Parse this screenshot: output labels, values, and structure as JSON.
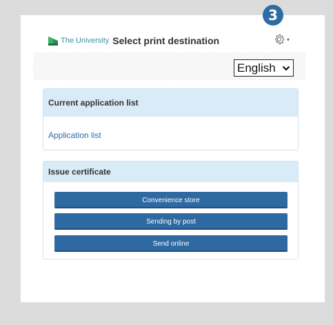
{
  "step": {
    "number": "3"
  },
  "header": {
    "logo_text": "The University",
    "title": "Select print destination",
    "settings_icon": "gear-icon"
  },
  "language": {
    "selected": "English"
  },
  "current_list": {
    "heading": "Current application list",
    "link_label": "Application list"
  },
  "issue": {
    "heading": "Issue certificate",
    "buttons": [
      {
        "label": "Convenience store"
      },
      {
        "label": "Sending by post"
      },
      {
        "label": "Send online"
      }
    ]
  },
  "colors": {
    "accent": "#2f69a2",
    "panel_header": "#d9ebf7",
    "link": "#2f6aa8",
    "badge": "#2e6da4"
  }
}
